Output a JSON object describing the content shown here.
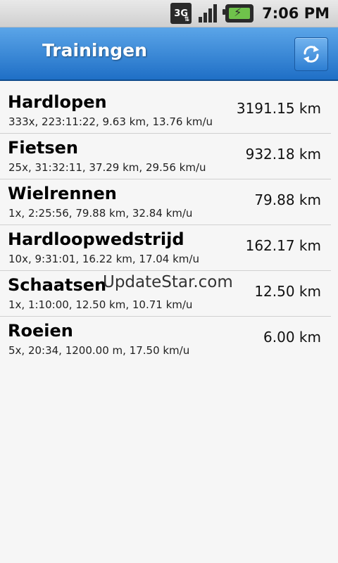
{
  "status_bar": {
    "network": "3G",
    "time": "7:06 PM"
  },
  "header": {
    "title": "Trainingen"
  },
  "list": [
    {
      "name": "Hardlopen",
      "stats": "333x, 223:11:22, 9.63 km, 13.76 km/u",
      "total": "3191.15 km"
    },
    {
      "name": "Fietsen",
      "stats": "25x, 31:32:11, 37.29 km, 29.56 km/u",
      "total": "932.18 km"
    },
    {
      "name": "Wielrennen",
      "stats": "1x, 2:25:56, 79.88 km, 32.84 km/u",
      "total": "79.88 km"
    },
    {
      "name": "Hardloopwedstrijd",
      "stats": "10x, 9:31:01, 16.22 km, 17.04 km/u",
      "total": "162.17 km"
    },
    {
      "name": "Schaatsen",
      "stats": "1x, 1:10:00, 12.50 km, 10.71 km/u",
      "total": "12.50 km"
    },
    {
      "name": "Roeien",
      "stats": "5x, 20:34, 1200.00 m, 17.50 km/u",
      "total": "6.00 km"
    }
  ],
  "watermark": "UpdateStar.com"
}
